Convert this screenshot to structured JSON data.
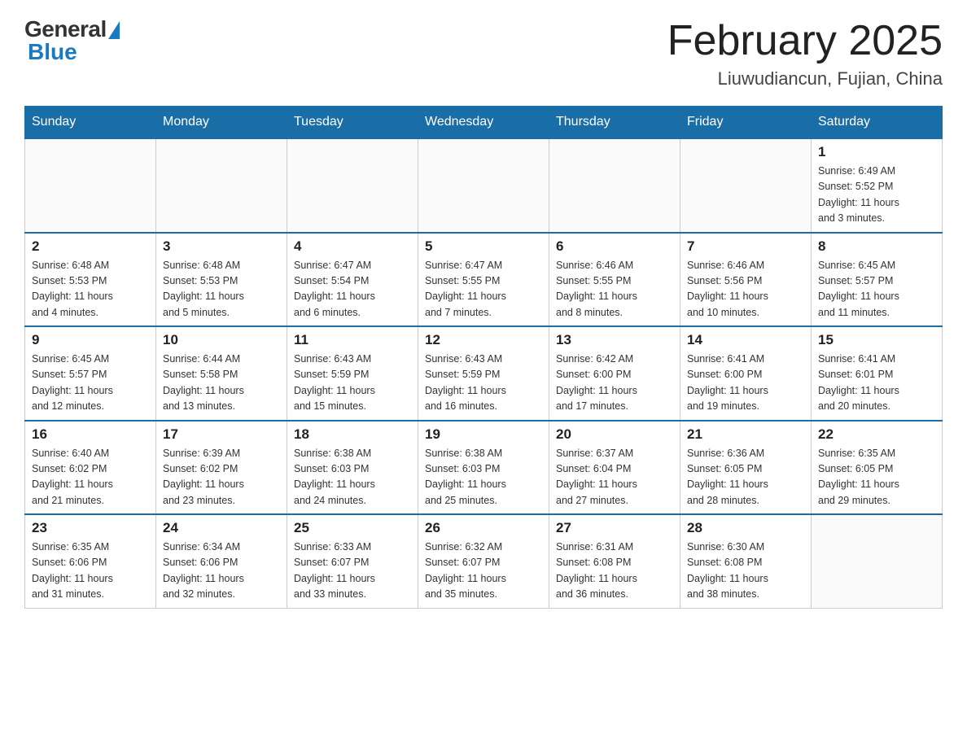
{
  "header": {
    "logo_general": "General",
    "logo_blue": "Blue",
    "month_title": "February 2025",
    "location": "Liuwudiancun, Fujian, China"
  },
  "weekdays": [
    "Sunday",
    "Monday",
    "Tuesday",
    "Wednesday",
    "Thursday",
    "Friday",
    "Saturday"
  ],
  "weeks": [
    [
      {
        "day": "",
        "info": ""
      },
      {
        "day": "",
        "info": ""
      },
      {
        "day": "",
        "info": ""
      },
      {
        "day": "",
        "info": ""
      },
      {
        "day": "",
        "info": ""
      },
      {
        "day": "",
        "info": ""
      },
      {
        "day": "1",
        "info": "Sunrise: 6:49 AM\nSunset: 5:52 PM\nDaylight: 11 hours\nand 3 minutes."
      }
    ],
    [
      {
        "day": "2",
        "info": "Sunrise: 6:48 AM\nSunset: 5:53 PM\nDaylight: 11 hours\nand 4 minutes."
      },
      {
        "day": "3",
        "info": "Sunrise: 6:48 AM\nSunset: 5:53 PM\nDaylight: 11 hours\nand 5 minutes."
      },
      {
        "day": "4",
        "info": "Sunrise: 6:47 AM\nSunset: 5:54 PM\nDaylight: 11 hours\nand 6 minutes."
      },
      {
        "day": "5",
        "info": "Sunrise: 6:47 AM\nSunset: 5:55 PM\nDaylight: 11 hours\nand 7 minutes."
      },
      {
        "day": "6",
        "info": "Sunrise: 6:46 AM\nSunset: 5:55 PM\nDaylight: 11 hours\nand 8 minutes."
      },
      {
        "day": "7",
        "info": "Sunrise: 6:46 AM\nSunset: 5:56 PM\nDaylight: 11 hours\nand 10 minutes."
      },
      {
        "day": "8",
        "info": "Sunrise: 6:45 AM\nSunset: 5:57 PM\nDaylight: 11 hours\nand 11 minutes."
      }
    ],
    [
      {
        "day": "9",
        "info": "Sunrise: 6:45 AM\nSunset: 5:57 PM\nDaylight: 11 hours\nand 12 minutes."
      },
      {
        "day": "10",
        "info": "Sunrise: 6:44 AM\nSunset: 5:58 PM\nDaylight: 11 hours\nand 13 minutes."
      },
      {
        "day": "11",
        "info": "Sunrise: 6:43 AM\nSunset: 5:59 PM\nDaylight: 11 hours\nand 15 minutes."
      },
      {
        "day": "12",
        "info": "Sunrise: 6:43 AM\nSunset: 5:59 PM\nDaylight: 11 hours\nand 16 minutes."
      },
      {
        "day": "13",
        "info": "Sunrise: 6:42 AM\nSunset: 6:00 PM\nDaylight: 11 hours\nand 17 minutes."
      },
      {
        "day": "14",
        "info": "Sunrise: 6:41 AM\nSunset: 6:00 PM\nDaylight: 11 hours\nand 19 minutes."
      },
      {
        "day": "15",
        "info": "Sunrise: 6:41 AM\nSunset: 6:01 PM\nDaylight: 11 hours\nand 20 minutes."
      }
    ],
    [
      {
        "day": "16",
        "info": "Sunrise: 6:40 AM\nSunset: 6:02 PM\nDaylight: 11 hours\nand 21 minutes."
      },
      {
        "day": "17",
        "info": "Sunrise: 6:39 AM\nSunset: 6:02 PM\nDaylight: 11 hours\nand 23 minutes."
      },
      {
        "day": "18",
        "info": "Sunrise: 6:38 AM\nSunset: 6:03 PM\nDaylight: 11 hours\nand 24 minutes."
      },
      {
        "day": "19",
        "info": "Sunrise: 6:38 AM\nSunset: 6:03 PM\nDaylight: 11 hours\nand 25 minutes."
      },
      {
        "day": "20",
        "info": "Sunrise: 6:37 AM\nSunset: 6:04 PM\nDaylight: 11 hours\nand 27 minutes."
      },
      {
        "day": "21",
        "info": "Sunrise: 6:36 AM\nSunset: 6:05 PM\nDaylight: 11 hours\nand 28 minutes."
      },
      {
        "day": "22",
        "info": "Sunrise: 6:35 AM\nSunset: 6:05 PM\nDaylight: 11 hours\nand 29 minutes."
      }
    ],
    [
      {
        "day": "23",
        "info": "Sunrise: 6:35 AM\nSunset: 6:06 PM\nDaylight: 11 hours\nand 31 minutes."
      },
      {
        "day": "24",
        "info": "Sunrise: 6:34 AM\nSunset: 6:06 PM\nDaylight: 11 hours\nand 32 minutes."
      },
      {
        "day": "25",
        "info": "Sunrise: 6:33 AM\nSunset: 6:07 PM\nDaylight: 11 hours\nand 33 minutes."
      },
      {
        "day": "26",
        "info": "Sunrise: 6:32 AM\nSunset: 6:07 PM\nDaylight: 11 hours\nand 35 minutes."
      },
      {
        "day": "27",
        "info": "Sunrise: 6:31 AM\nSunset: 6:08 PM\nDaylight: 11 hours\nand 36 minutes."
      },
      {
        "day": "28",
        "info": "Sunrise: 6:30 AM\nSunset: 6:08 PM\nDaylight: 11 hours\nand 38 minutes."
      },
      {
        "day": "",
        "info": ""
      }
    ]
  ]
}
